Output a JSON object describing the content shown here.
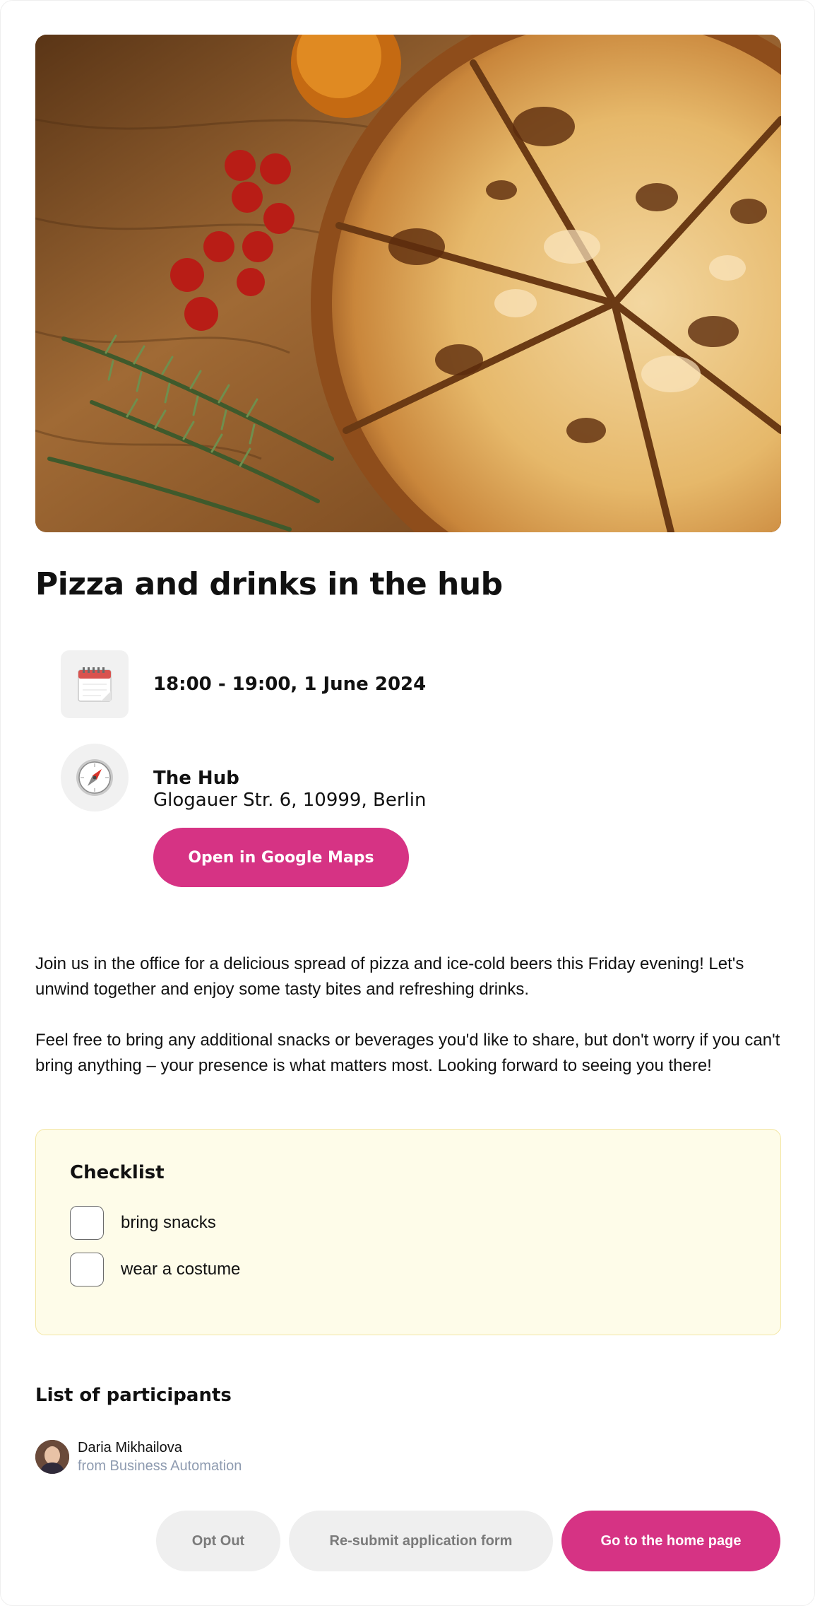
{
  "event": {
    "title": "Pizza and drinks in the hub",
    "datetime": "18:00 - 19:00, 1 June 2024",
    "location": {
      "name": "The Hub",
      "address": "Glogauer Str. 6, 10999, Berlin",
      "maps_button_label": "Open in Google Maps"
    },
    "description": [
      "Join us in the office for a delicious spread of pizza and ice-cold beers this Friday evening! Let's unwind together and enjoy some tasty bites and refreshing drinks.",
      "Feel free to bring any additional snacks or beverages you'd like to share, but don't worry if you can't bring anything – your presence is what matters most. Looking forward to seeing you there!"
    ]
  },
  "icons": {
    "datetime": "calendar-icon",
    "location": "compass-icon",
    "hero": "pizza-photo"
  },
  "checklist": {
    "title": "Checklist",
    "items": [
      {
        "label": "bring snacks",
        "checked": false
      },
      {
        "label": "wear a costume",
        "checked": false
      }
    ]
  },
  "participants": {
    "title": "List of participants",
    "items": [
      {
        "name": "Daria Mikhailova",
        "org": "from Business Automation"
      }
    ]
  },
  "actions": {
    "opt_out_label": "Opt Out",
    "resubmit_label": "Re-submit application form",
    "home_label": "Go to the home page"
  },
  "colors": {
    "accent": "#d63384",
    "checklist_bg": "#fefce9",
    "checklist_border": "#f3e6a4",
    "muted_button_bg": "#efefef",
    "secondary_text": "#8e9bb0"
  }
}
